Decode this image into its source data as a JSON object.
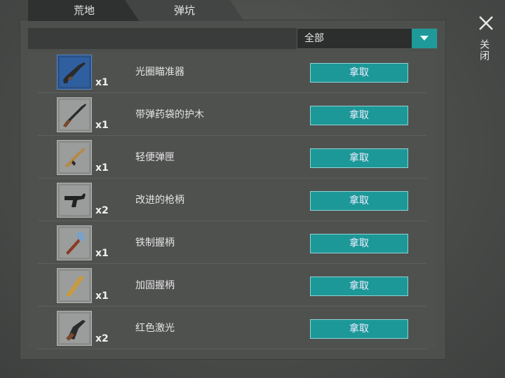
{
  "tabs": [
    "荒地",
    "弹坑"
  ],
  "filter": {
    "selected": "全部"
  },
  "close_label": "关闭",
  "items": [
    {
      "name": "光圈瞄准器",
      "qty": "x1",
      "icon": "shotgun-icon",
      "action": "拿取"
    },
    {
      "name": "带弹药袋的护木",
      "qty": "x1",
      "icon": "rifle-icon",
      "action": "拿取"
    },
    {
      "name": "轻便弹匣",
      "qty": "x1",
      "icon": "assault-rifle-icon",
      "action": "拿取"
    },
    {
      "name": "改进的枪柄",
      "qty": "x2",
      "icon": "smg-icon",
      "action": "拿取"
    },
    {
      "name": "铁制握柄",
      "qty": "x1",
      "icon": "sledgehammer-icon",
      "action": "拿取"
    },
    {
      "name": "加固握柄",
      "qty": "x1",
      "icon": "wooden-plank-icon",
      "action": "拿取"
    },
    {
      "name": "红色激光",
      "qty": "x2",
      "icon": "pistol-icon",
      "action": "拿取"
    }
  ],
  "colors": {
    "accent": "#1d9898",
    "blueprint_rare": "#2f5f9e"
  }
}
